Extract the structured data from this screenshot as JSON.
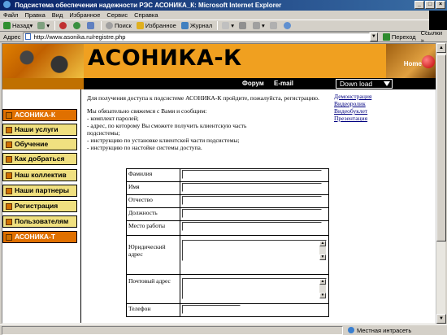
{
  "window": {
    "title": "Подсистема обеспечения надежности РЭС АСОНИКА_К: Microsoft Internet Explorer"
  },
  "menubar": [
    "Файл",
    "Правка",
    "Вид",
    "Избранное",
    "Сервис",
    "Справка"
  ],
  "toolbar": {
    "back": "Назад",
    "search": "Поиск",
    "favorites": "Избранное",
    "journal": "Журнал"
  },
  "address": {
    "label": "Адрес",
    "url": "http://www.asonika.ru/registre.php",
    "go": "Переход",
    "links": "Ссылки »"
  },
  "banner": {
    "title": "АСОНИКА-К",
    "home": "Home",
    "nav": {
      "forum": "Форум",
      "email": "E-mail",
      "download": "Down load"
    }
  },
  "sidebar": {
    "items": [
      {
        "label": "АСОНИКА-К",
        "active": true
      },
      {
        "label": "Наши услуги",
        "active": false
      },
      {
        "label": "Обучение",
        "active": false
      },
      {
        "label": "Как добраться",
        "active": false
      },
      {
        "label": "Наш коллектив",
        "active": false
      },
      {
        "label": "Наши партнеры",
        "active": false
      },
      {
        "label": "Регистрация",
        "active": false
      },
      {
        "label": "Пользователям",
        "active": false
      },
      {
        "label": "АСОНИКА-Т",
        "active": true
      }
    ]
  },
  "content": {
    "intro": "Для получения доступа к подсистеме АСОНИКА-К пройдите, пожалуйста, регистрацию.",
    "contact": "Мы обязательно свяжемся с Вами и сообщим:",
    "bullets": [
      "- комплект паролей;",
      "- адрес, по которому Вы сможете получить клиентскую часть",
      "подсистемы;",
      "- инструкцию по установке клиентской части подсистемы;",
      "- инструкцию по настойке системы доступа."
    ]
  },
  "rightlinks": [
    "Демонстрация",
    "Видеоролик",
    "Видеобуклет",
    "Презентация"
  ],
  "form": {
    "fields": [
      {
        "label": "Фамилия",
        "type": "input"
      },
      {
        "label": "Имя",
        "type": "input"
      },
      {
        "label": "Отчество",
        "type": "input"
      },
      {
        "label": "Должность",
        "type": "input"
      },
      {
        "label": "Место работы",
        "type": "input"
      },
      {
        "label": "Юридический адрес",
        "type": "textarea"
      },
      {
        "label": "Почтовый адрес",
        "type": "textarea"
      },
      {
        "label": "Телефон",
        "type": "input"
      }
    ]
  },
  "statusbar": {
    "zone": "Местная интрасеть"
  }
}
